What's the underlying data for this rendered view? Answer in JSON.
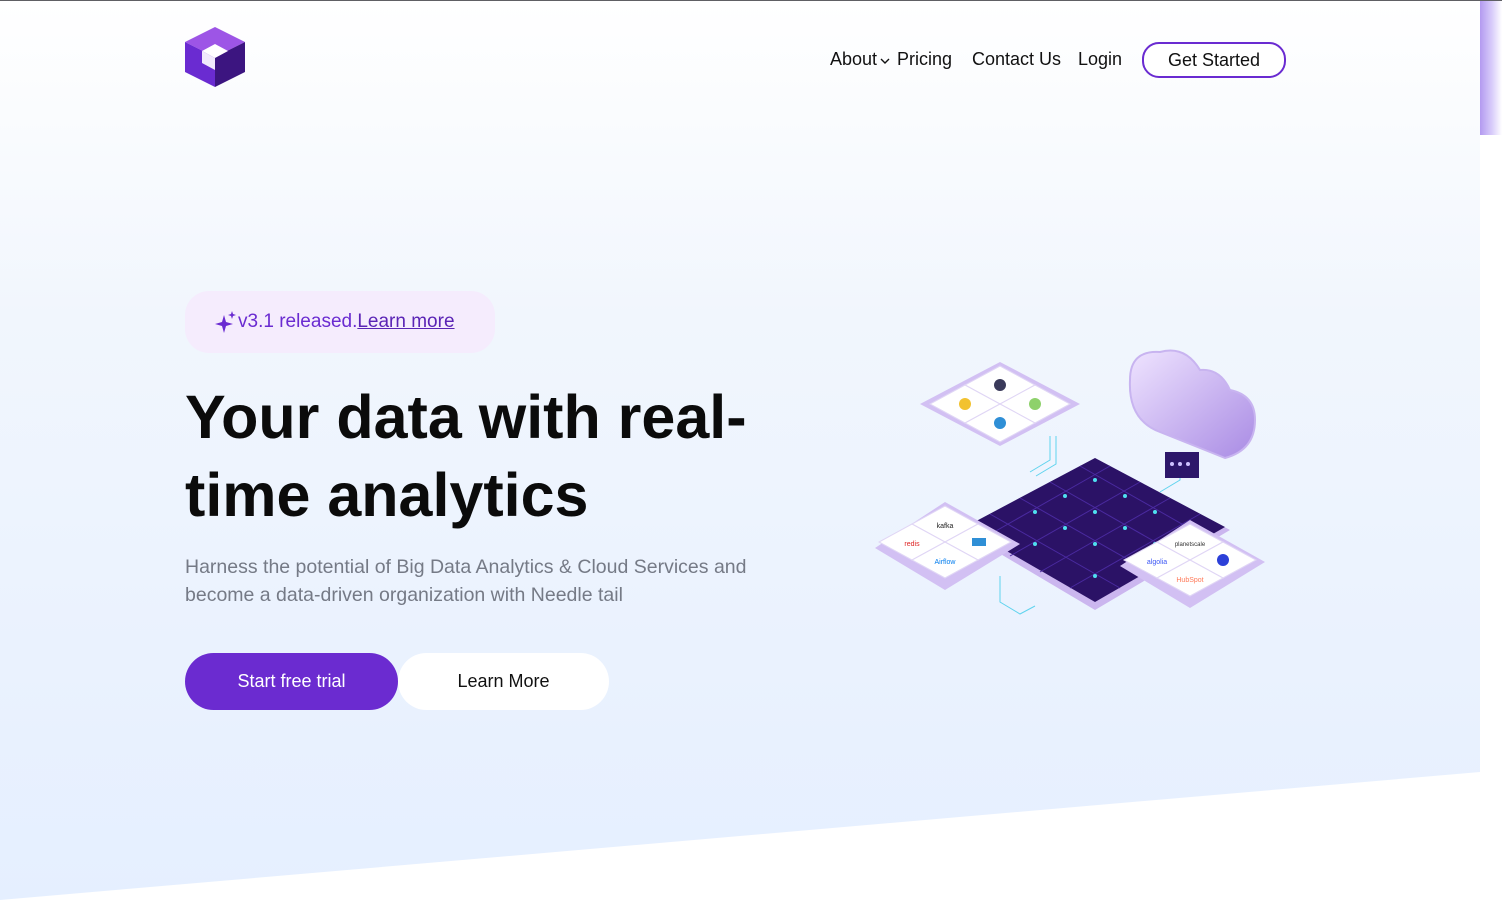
{
  "header": {
    "logo_icon": "cube-logo-icon",
    "nav": {
      "about": "About",
      "pricing": "Pricing",
      "contact": "Contact Us",
      "login": "Login",
      "cta": "Get Started"
    }
  },
  "hero": {
    "badge": {
      "icon": "sparkle-icon",
      "text": "v3.1 released.",
      "link": "Learn more"
    },
    "headline": "Your data with real-time analytics",
    "subtext": "Harness the potential of Big Data Analytics & Cloud Services and become a data-driven organization with Needle tail",
    "primary_button": "Start free trial",
    "secondary_button": "Learn More"
  },
  "illustration": {
    "tiles": [
      {
        "label": "kafka"
      },
      {
        "label": "redis"
      },
      {
        "label": "Airflow"
      },
      {
        "label": "algolia"
      },
      {
        "label": "HubSpot"
      },
      {
        "label": "planetscale"
      }
    ]
  },
  "colors": {
    "accent": "#6b2bd0",
    "badge_bg": "#f5ecfd",
    "text_muted": "#757a86"
  }
}
